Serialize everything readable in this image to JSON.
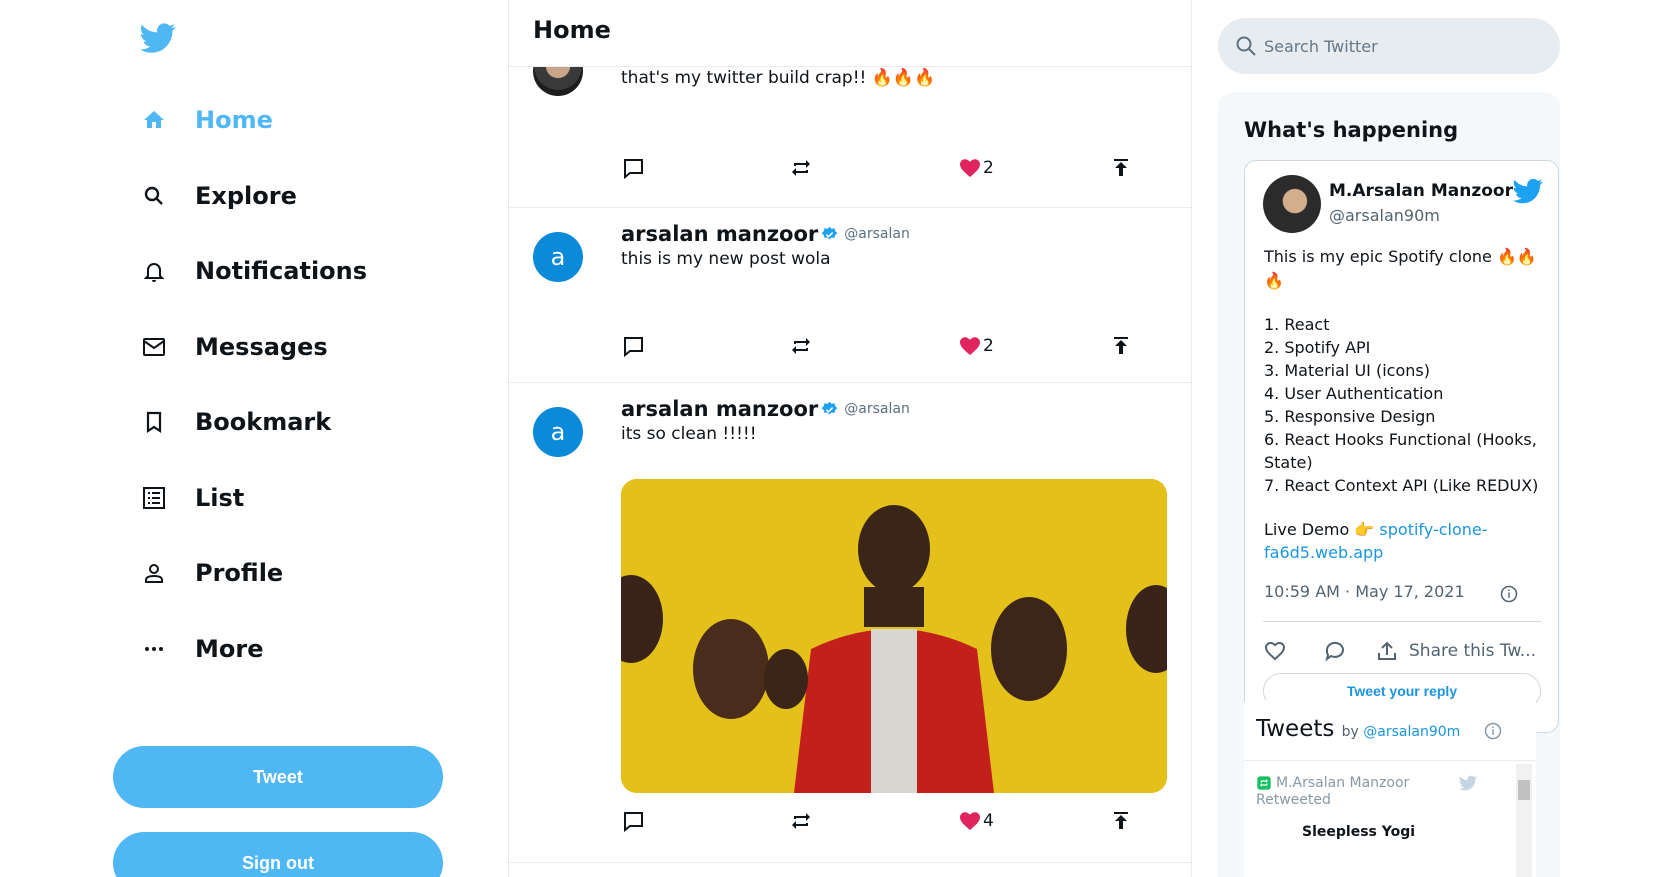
{
  "nav": {
    "items": [
      {
        "label": "Home",
        "icon": "home-icon"
      },
      {
        "label": "Explore",
        "icon": "search-icon"
      },
      {
        "label": "Notifications",
        "icon": "bell-icon"
      },
      {
        "label": "Messages",
        "icon": "mail-icon"
      },
      {
        "label": "Bookmark",
        "icon": "bookmark-icon"
      },
      {
        "label": "List",
        "icon": "list-icon"
      },
      {
        "label": "Profile",
        "icon": "person-icon"
      },
      {
        "label": "More",
        "icon": "more-horizontal-icon"
      }
    ],
    "tweet_button": "Tweet",
    "signout_button": "Sign out"
  },
  "feed": {
    "title": "Home",
    "posts": [
      {
        "name": "",
        "handle": "",
        "text": "that's my twitter build crap!! 🔥🔥🔥",
        "likes": "2"
      },
      {
        "name": "arsalan manzoor",
        "handle": "@arsalan",
        "avatar_letter": "a",
        "text": "this is my new post wola",
        "likes": "2"
      },
      {
        "name": "arsalan manzoor",
        "handle": "@arsalan",
        "avatar_letter": "a",
        "text": "its so clean !!!!!",
        "likes": "4"
      }
    ]
  },
  "search": {
    "placeholder": "Search Twitter"
  },
  "widget": {
    "title": "What's happening",
    "embed": {
      "name": "M.Arsalan Manzoor",
      "handle": "@arsalan90m",
      "line1": "This is my epic Spotify clone 🔥🔥",
      "line2": "🔥",
      "list": [
        "1. React",
        "2. Spotify API",
        "3. Material UI (icons)",
        "4. User Authentication",
        "5. Responsive Design",
        "6. React Hooks Functional (Hooks,",
        "State)",
        "7. React Context API (Like REDUX)"
      ],
      "demo_label": "Live Demo 👉",
      "demo_link_1": "spotify-clone-",
      "demo_link_2": "fa6d5.web.app",
      "timestamp": "10:59 AM · May 17, 2021",
      "share_label": "Share this Tw...",
      "reply_button": "Tweet your reply"
    },
    "timeline": {
      "title": "Tweets",
      "by_prefix": "by",
      "by_handle": "@arsalan90m",
      "item_name": "M.Arsalan Manzoor",
      "item_status": "Retweeted",
      "item_next": "Sleepless Yogi"
    }
  },
  "colors": {
    "accent": "#50b7f5",
    "verified": "#1da1f2",
    "heart": "#e0245e",
    "avatar": "#0a8ad8"
  }
}
